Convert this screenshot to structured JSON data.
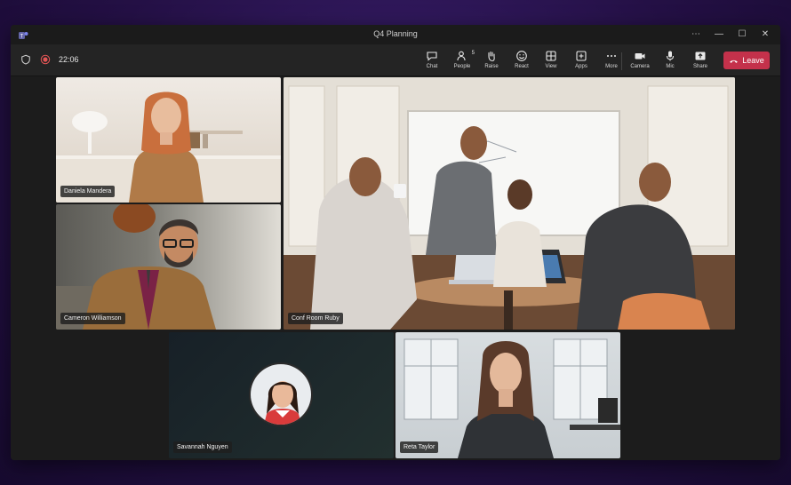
{
  "window": {
    "title": "Q4 Planning"
  },
  "toolbar": {
    "time": "22:06",
    "people_count": "5",
    "buttons": [
      {
        "label": "Chat",
        "icon": "chat-icon"
      },
      {
        "label": "People",
        "icon": "people-icon"
      },
      {
        "label": "Raise",
        "icon": "hand-icon"
      },
      {
        "label": "React",
        "icon": "smile-icon"
      },
      {
        "label": "View",
        "icon": "grid-icon"
      },
      {
        "label": "Apps",
        "icon": "plus-square-icon"
      },
      {
        "label": "More",
        "icon": "more-icon"
      },
      {
        "label": "Camera",
        "icon": "camera-icon"
      },
      {
        "label": "Mic",
        "icon": "mic-icon"
      },
      {
        "label": "Share",
        "icon": "share-icon"
      }
    ],
    "leave_label": "Leave"
  },
  "participants": [
    {
      "name": "Daniela Mandera"
    },
    {
      "name": "Conf Room Ruby"
    },
    {
      "name": "Cameron Williamson"
    },
    {
      "name": "Savannah Nguyen"
    },
    {
      "name": "Reta Taylor"
    }
  ],
  "colors": {
    "leave": "#c4314b",
    "record": "#e25555",
    "background": "#2a1550"
  }
}
